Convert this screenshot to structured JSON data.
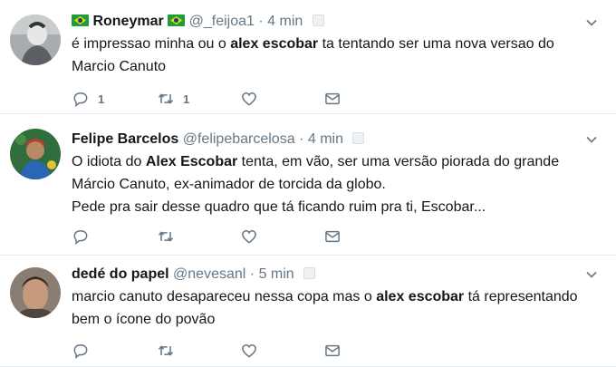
{
  "tweets": [
    {
      "fullname": "Roneymar",
      "handle": "@_feijoa1",
      "separator": "·",
      "time": "4 min",
      "text_before": "é impressao minha ou o ",
      "text_bold": "alex escobar",
      "text_after_line1": " ta tentando ser uma nova versao do",
      "text_line2": "Marcio Canuto",
      "reply_count": "1",
      "retweet_count": "1"
    },
    {
      "fullname": "Felipe Barcelos",
      "handle": "@felipebarcelosa",
      "separator": "·",
      "time": "4 min",
      "text_before": "O idiota do ",
      "text_bold": "Alex Escobar",
      "text_after_line1": " tenta, em vão, ser uma versão piorada do grande",
      "text_line2": "Márcio Canuto, ex-animador de torcida da globo.",
      "text_line3": "Pede pra sair desse quadro que tá ficando ruim pra ti, Escobar..."
    },
    {
      "fullname": "dedé do papel",
      "handle": "@nevesanl",
      "separator": "·",
      "time": "5 min",
      "text_before": "marcio canuto desapareceu nessa copa mas o ",
      "text_bold": "alex escobar",
      "text_after_line1": " tá representando",
      "text_line2": "bem o ícone do povão"
    }
  ],
  "colors": {
    "text": "#14171a",
    "muted": "#657786",
    "divider": "#e6ecf0"
  },
  "icons": [
    "reply-icon",
    "retweet-icon",
    "like-icon",
    "direct-message-icon",
    "chevron-down-icon",
    "brazil-flag-icon"
  ]
}
